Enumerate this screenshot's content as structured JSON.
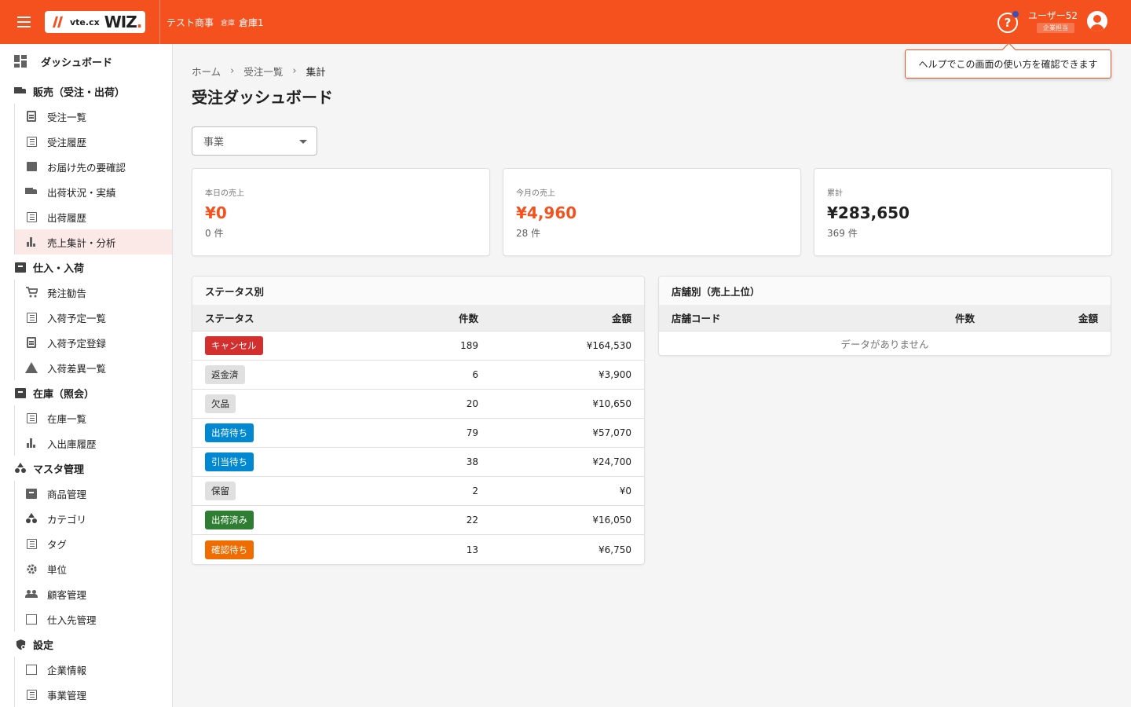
{
  "header": {
    "logo_vte": "vte.cx",
    "logo_wiz": "WIZ",
    "logo_dot": ".",
    "company": "テスト商事",
    "warehouse_label": "倉庫",
    "warehouse_value": "倉庫1",
    "help_icon_glyph": "?",
    "user_name": "ユーザー52",
    "user_role": "企業担当",
    "brand_color": "#f4511e"
  },
  "tooltip": {
    "text": "ヘルプでこの画面の使い方を確認できます"
  },
  "sidebar": {
    "top": {
      "label": "ダッシュボード",
      "icon": "dashboard-icon"
    },
    "groups": [
      {
        "label": "販売（受注・出荷）",
        "icon": "truck-icon",
        "items": [
          {
            "label": "受注一覧",
            "icon": "clipboard-icon"
          },
          {
            "label": "受注履歴",
            "icon": "list-icon"
          },
          {
            "label": "お届け先の要確認",
            "icon": "checklist-icon"
          },
          {
            "label": "出荷状況・実績",
            "icon": "truck-icon"
          },
          {
            "label": "出荷履歴",
            "icon": "list-icon"
          },
          {
            "label": "売上集計・分析",
            "icon": "bar-chart-icon",
            "active": true
          }
        ]
      },
      {
        "label": "仕入・入荷",
        "icon": "inbox-icon",
        "items": [
          {
            "label": "発注勧告",
            "icon": "cart-icon"
          },
          {
            "label": "入荷予定一覧",
            "icon": "list-icon"
          },
          {
            "label": "入荷予定登録",
            "icon": "clipboard-icon"
          },
          {
            "label": "入荷差異一覧",
            "icon": "warning-icon"
          }
        ]
      },
      {
        "label": "在庫（照会）",
        "icon": "archive-icon",
        "items": [
          {
            "label": "在庫一覧",
            "icon": "list-icon"
          },
          {
            "label": "入出庫履歴",
            "icon": "bar-chart-icon"
          }
        ]
      },
      {
        "label": "マスタ管理",
        "icon": "shapes-icon",
        "items": [
          {
            "label": "商品管理",
            "icon": "archive-icon"
          },
          {
            "label": "カテゴリ",
            "icon": "shapes-icon"
          },
          {
            "label": "タグ",
            "icon": "list-icon"
          },
          {
            "label": "単位",
            "icon": "gear-icon"
          },
          {
            "label": "顧客管理",
            "icon": "people-icon"
          },
          {
            "label": "仕入先管理",
            "icon": "building-icon"
          }
        ]
      },
      {
        "label": "設定",
        "icon": "shield-gear-icon",
        "items": [
          {
            "label": "企業情報",
            "icon": "building-icon"
          },
          {
            "label": "事業管理",
            "icon": "list-icon"
          }
        ]
      }
    ]
  },
  "breadcrumb": {
    "home": "ホーム",
    "orders": "受注一覧",
    "current": "集計",
    "separator": "›"
  },
  "page": {
    "title": "受注ダッシュボード"
  },
  "filter": {
    "business_placeholder": "事業"
  },
  "stats": [
    {
      "label": "本日の売上",
      "value": "¥0",
      "count": "0 件",
      "accent": true
    },
    {
      "label": "今月の売上",
      "value": "¥4,960",
      "count": "28 件",
      "accent": true
    },
    {
      "label": "累計",
      "value": "¥283,650",
      "count": "369 件",
      "accent": false
    }
  ],
  "status_panel": {
    "title": "ステータス別",
    "columns": [
      "ステータス",
      "件数",
      "金額"
    ],
    "rows": [
      {
        "status": "キャンセル",
        "count": "189",
        "amount": "¥164,530",
        "bg": "#d32f2f",
        "fg": "#ffffff"
      },
      {
        "status": "返金済",
        "count": "6",
        "amount": "¥3,900",
        "bg": "#e0e0e0",
        "fg": "#212121"
      },
      {
        "status": "欠品",
        "count": "20",
        "amount": "¥10,650",
        "bg": "#e0e0e0",
        "fg": "#212121"
      },
      {
        "status": "出荷待ち",
        "count": "79",
        "amount": "¥57,070",
        "bg": "#0288d1",
        "fg": "#ffffff"
      },
      {
        "status": "引当待ち",
        "count": "38",
        "amount": "¥24,700",
        "bg": "#0288d1",
        "fg": "#ffffff"
      },
      {
        "status": "保留",
        "count": "2",
        "amount": "¥0",
        "bg": "#e0e0e0",
        "fg": "#212121"
      },
      {
        "status": "出荷済み",
        "count": "22",
        "amount": "¥16,050",
        "bg": "#2e7d32",
        "fg": "#ffffff"
      },
      {
        "status": "確認待ち",
        "count": "13",
        "amount": "¥6,750",
        "bg": "#ef6c00",
        "fg": "#ffffff"
      }
    ]
  },
  "shop_panel": {
    "title": "店舗別（売上上位）",
    "columns": [
      "店舗コード",
      "件数",
      "金額"
    ],
    "empty": "データがありません"
  }
}
